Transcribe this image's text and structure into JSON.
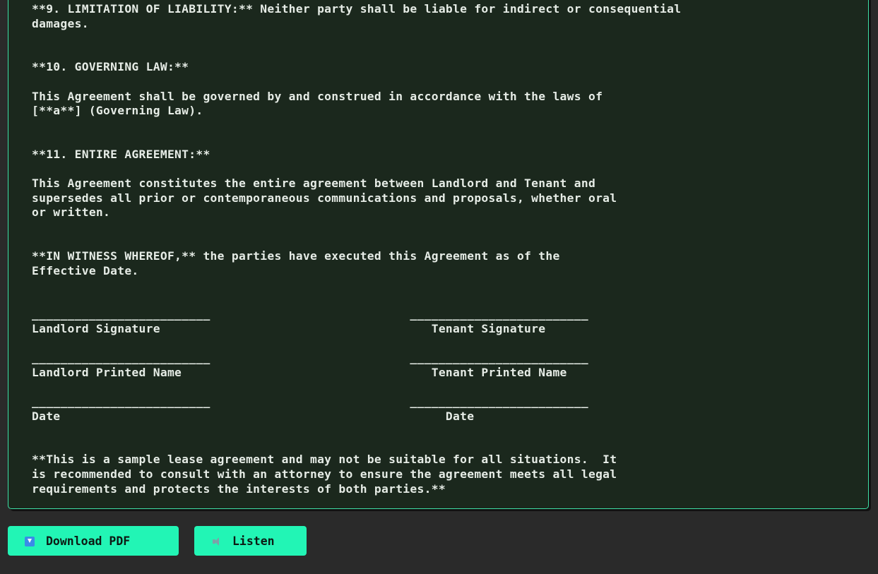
{
  "document": {
    "text": "**9. LIMITATION OF LIABILITY:** Neither party shall be liable for indirect or consequential\ndamages.\n\n\n**10. GOVERNING LAW:**\n\nThis Agreement shall be governed by and construed in accordance with the laws of\n[**a**] (Governing Law).\n\n\n**11. ENTIRE AGREEMENT:**\n\nThis Agreement constitutes the entire agreement between Landlord and Tenant and\nsupersedes all prior or contemporaneous communications and proposals, whether oral\nor written.\n\n\n**IN WITNESS WHEREOF,** the parties have executed this Agreement as of the\nEffective Date.\n\n\n_________________________                            _________________________\nLandlord Signature                                      Tenant Signature\n\n_________________________                            _________________________\nLandlord Printed Name                                   Tenant Printed Name\n\n_________________________                            _________________________\nDate                                                      Date\n\n\n**This is a sample lease agreement and may not be suitable for all situations.  It\nis recommended to consult with an attorney to ensure the agreement meets all legal\nrequirements and protects the interests of both parties.**"
  },
  "actions": {
    "download_label": "Download PDF",
    "download_icon": "download-arrow-icon",
    "listen_label": "Listen",
    "listen_icon": "speaker-icon"
  },
  "colors": {
    "background": "#2a2a2a",
    "panel": "#1b281d",
    "panel_border": "#3ee0a6",
    "text": "#e6ece6",
    "button": "#22f5b5"
  }
}
